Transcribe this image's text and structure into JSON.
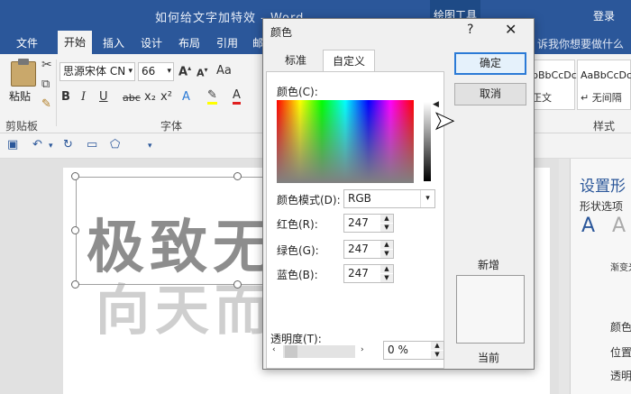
{
  "word": {
    "title": "如何给文字加特效 - Word",
    "drawing_tools": "绘图工具",
    "login": "登录",
    "tabs": [
      "文件",
      "开始",
      "插入",
      "设计",
      "布局",
      "引用",
      "邮"
    ],
    "tell_me": "诉我你想要做什么",
    "clipboard": {
      "paste": "粘贴",
      "group_label": "剪贴板"
    },
    "font": {
      "name": "思源宋体 CN",
      "size": "66",
      "group_label": "字体",
      "bold": "B",
      "italic": "I",
      "underline": "U",
      "strike": "abc",
      "sub": "x₂",
      "sup": "x²"
    },
    "styles": {
      "group_label": "样式",
      "items": [
        {
          "preview": "bBbCcDc",
          "name": "正文"
        },
        {
          "preview": "AaBbCcDc",
          "name": "↵ 无间隔"
        }
      ]
    }
  },
  "document": {
    "line1": "极致无",
    "line2": "向天而"
  },
  "pane": {
    "title": "设置形",
    "subtitle": "形状选项",
    "items": [
      "渐变光",
      "颜色",
      "位置",
      "透明"
    ]
  },
  "dialog": {
    "title": "颜色",
    "help": "?",
    "close": "✕",
    "tabs": [
      "标准",
      "自定义"
    ],
    "colors_label": "颜色(C):",
    "mode_label": "颜色模式(D):",
    "mode_value": "RGB",
    "red_label": "红色(R):",
    "red_value": "247",
    "green_label": "绿色(G):",
    "green_value": "247",
    "blue_label": "蓝色(B):",
    "blue_value": "247",
    "transparency_label": "透明度(T):",
    "transparency_value": "0 %",
    "ok": "确定",
    "cancel": "取消",
    "new": "新增",
    "current": "当前"
  }
}
